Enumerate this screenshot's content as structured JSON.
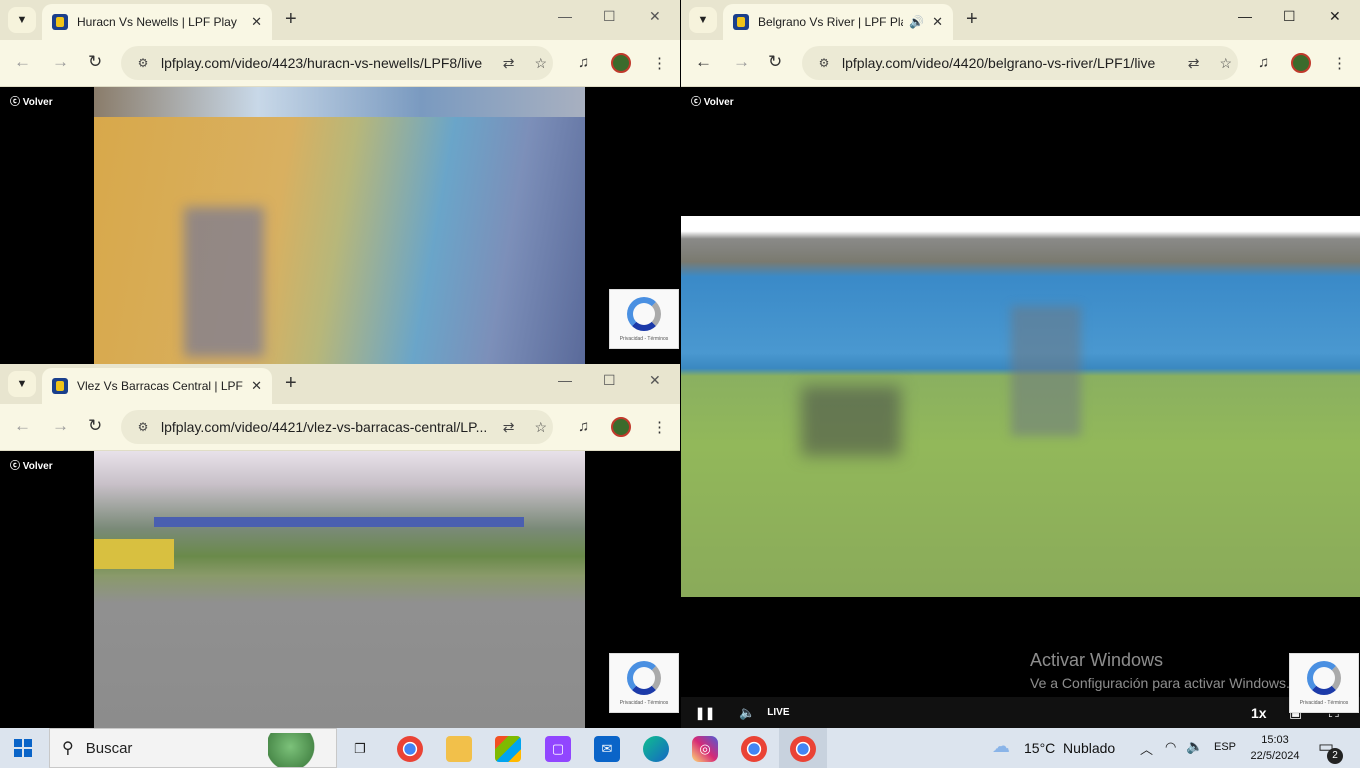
{
  "windows": {
    "huracan": {
      "tab_title": "Huracn Vs Newells | LPF Play",
      "url": "lpfplay.com/video/4423/huracn-vs-newells/LPF8/live",
      "volver_label": "Volver",
      "recaptcha_label": "Privacidad - Términos"
    },
    "velez": {
      "tab_title": "Vlez Vs Barracas Central | LPF Pl",
      "url": "lpfplay.com/video/4421/vlez-vs-barracas-central/LP...",
      "volver_label": "Volver",
      "recaptcha_label": "Privacidad - Términos"
    },
    "belgrano": {
      "tab_title": "Belgrano Vs River | LPF Play",
      "url": "lpfplay.com/video/4420/belgrano-vs-river/LPF1/live",
      "volver_label": "Volver",
      "live_label": "LIVE",
      "speed_label": "1x",
      "recaptcha_label": "Privacidad - Términos"
    }
  },
  "activation": {
    "title": "Activar Windows",
    "subtitle": "Ve a Configuración para activar Windows."
  },
  "taskbar": {
    "search_placeholder": "Buscar",
    "weather": "15°C  Nublado",
    "language": "ESP",
    "time": "15:03",
    "date": "22/5/2024",
    "notification_count": "2"
  }
}
